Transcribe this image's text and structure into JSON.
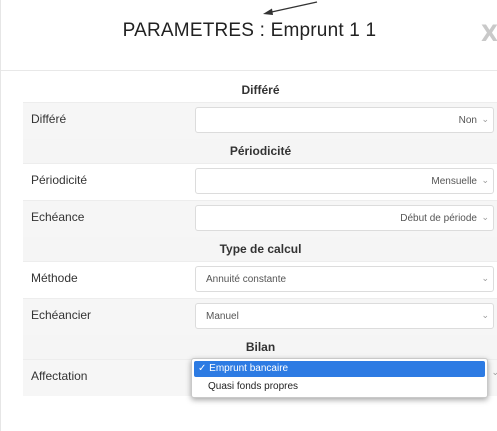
{
  "dialog": {
    "title": "PARAMETRES : Emprunt 1 1",
    "close_label": "X"
  },
  "sections": {
    "differe": "Différé",
    "periodicite": "Périodicité",
    "type_calcul": "Type de calcul",
    "bilan": "Bilan"
  },
  "fields": {
    "differe": {
      "label": "Différé",
      "value": "Non"
    },
    "periodicite": {
      "label": "Périodicité",
      "value": "Mensuelle"
    },
    "echeance": {
      "label": "Echéance",
      "value": "Début de période"
    },
    "methode": {
      "label": "Méthode",
      "value": "Annuité constante"
    },
    "echeancier": {
      "label": "Echéancier",
      "value": "Manuel"
    },
    "affectation": {
      "label": "Affectation",
      "options": [
        "Emprunt bancaire",
        "Quasi fonds propres"
      ],
      "selected": "Emprunt bancaire"
    }
  },
  "glyphs": {
    "check": "✓",
    "chevron": "⌄"
  },
  "colors": {
    "selected_option_bg": "#2d7be3"
  },
  "icons": {
    "arrow": "arrow-pointer-icon",
    "chevron": "chevron-down-icon",
    "check": "check-icon"
  }
}
